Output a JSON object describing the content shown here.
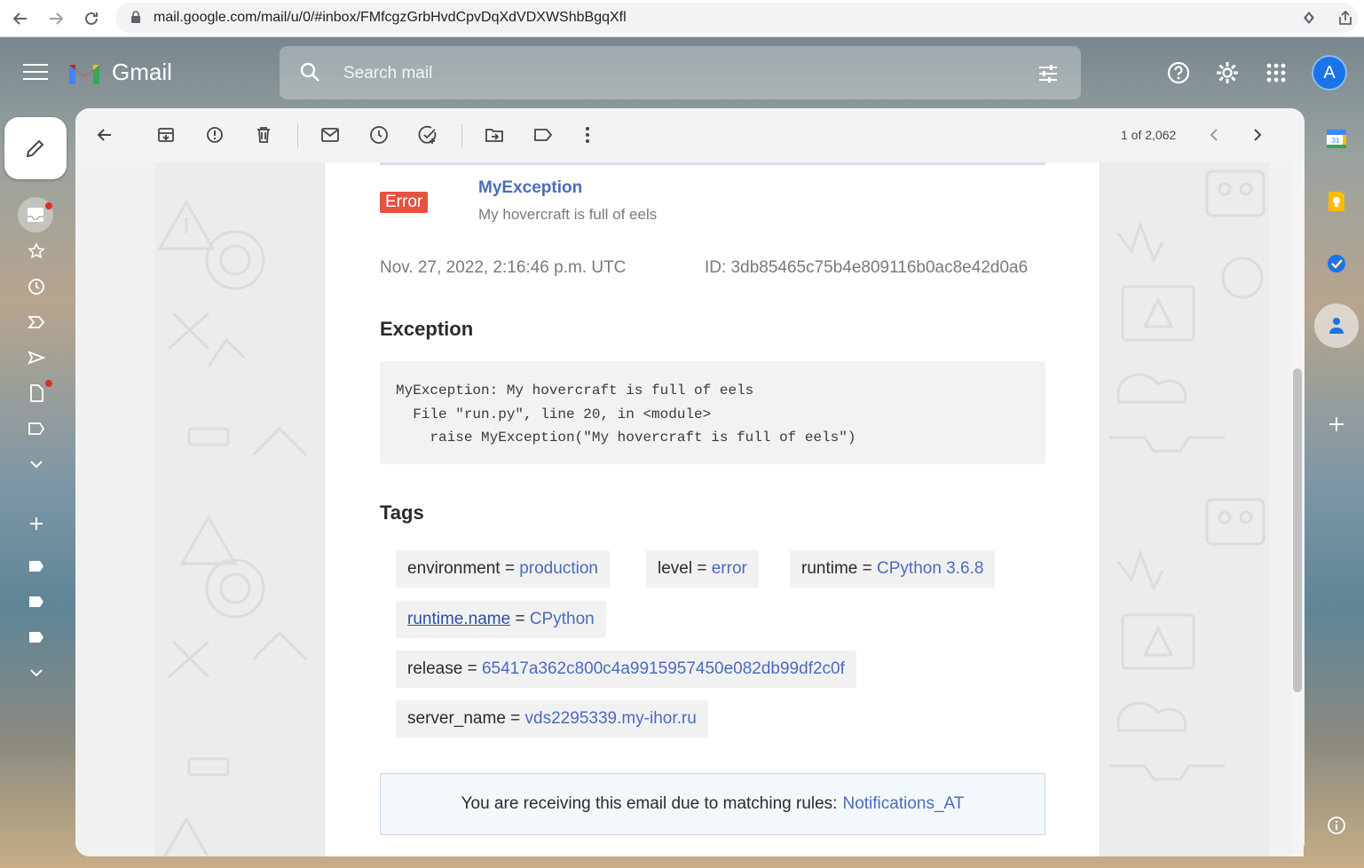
{
  "browser": {
    "url": "mail.google.com/mail/u/0/#inbox/FMfcgzGrbHvdCpvDqXdVDXWShbBgqXfl"
  },
  "header": {
    "brand": "Gmail",
    "search_placeholder": "Search mail",
    "avatar_letter": "A"
  },
  "toolbar": {
    "pager": "1 of 2,062"
  },
  "email": {
    "badge": "Error",
    "exception_title": "MyException",
    "exception_message": "My hovercraft is full of eels",
    "date": "Nov. 27, 2022, 2:16:46 p.m. UTC",
    "event_id": "ID: 3db85465c75b4e809116b0ac8e42d0a6",
    "exception_heading": "Exception",
    "stacktrace": "MyException: My hovercraft is full of eels\n  File \"run.py\", line 20, in <module>\n    raise MyException(\"My hovercraft is full of eels\")",
    "tags_heading": "Tags",
    "tags": [
      {
        "key": "environment",
        "sep": " = ",
        "value": "production"
      },
      {
        "key": "level",
        "sep": " = ",
        "value": "error"
      },
      {
        "key": "runtime",
        "sep": " = ",
        "value": "CPython 3.6.8"
      },
      {
        "key": "runtime.name",
        "sep": " = ",
        "value": "CPython"
      },
      {
        "key": "release",
        "sep": " = ",
        "value": "65417a362c800c4a9915957450e082db99df2c0f"
      },
      {
        "key": "server_name",
        "sep": " = ",
        "value": "vds2295339.my-ihor.ru"
      }
    ],
    "rules_text": "You are receiving this email due to matching rules:",
    "rules_link": "Notifications_AT"
  },
  "side_panel": {
    "calendar_day": "31"
  },
  "colors": {
    "accent_link": "#4a6bbd",
    "error_badge": "#e5523f",
    "gmail_blue": "#1a73e8"
  }
}
